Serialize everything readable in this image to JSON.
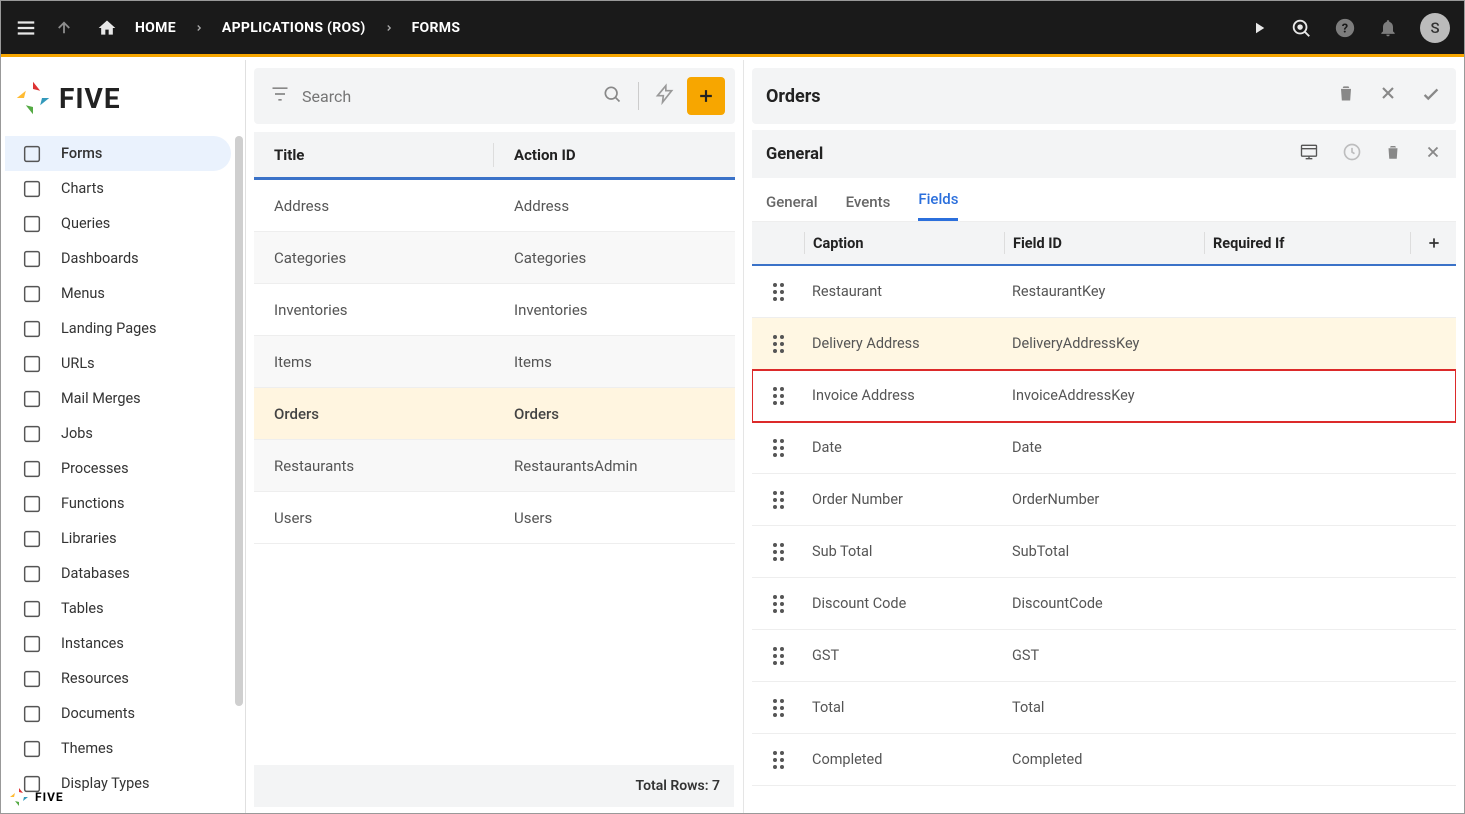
{
  "top": {
    "home": "HOME",
    "apps": "APPLICATIONS (ROS)",
    "forms": "FORMS",
    "avatar": "S"
  },
  "brand": {
    "name": "FIVE",
    "footer": "FIVE"
  },
  "sidebar": [
    {
      "label": "Forms",
      "sel": true
    },
    {
      "label": "Charts"
    },
    {
      "label": "Queries"
    },
    {
      "label": "Dashboards"
    },
    {
      "label": "Menus"
    },
    {
      "label": "Landing Pages"
    },
    {
      "label": "URLs"
    },
    {
      "label": "Mail Merges"
    },
    {
      "label": "Jobs"
    },
    {
      "label": "Processes"
    },
    {
      "label": "Functions"
    },
    {
      "label": "Libraries"
    },
    {
      "label": "Databases"
    },
    {
      "label": "Tables"
    },
    {
      "label": "Instances"
    },
    {
      "label": "Resources"
    },
    {
      "label": "Documents"
    },
    {
      "label": "Themes"
    },
    {
      "label": "Display Types"
    }
  ],
  "search": {
    "placeholder": "Search"
  },
  "listHead": {
    "title": "Title",
    "action": "Action ID"
  },
  "list": [
    {
      "title": "Address",
      "action": "Address"
    },
    {
      "title": "Categories",
      "action": "Categories"
    },
    {
      "title": "Inventories",
      "action": "Inventories"
    },
    {
      "title": "Items",
      "action": "Items"
    },
    {
      "title": "Orders",
      "action": "Orders",
      "sel": true
    },
    {
      "title": "Restaurants",
      "action": "RestaurantsAdmin"
    },
    {
      "title": "Users",
      "action": "Users"
    }
  ],
  "totalRows": "Total Rows: 7",
  "detail": {
    "title": "Orders",
    "section": "General"
  },
  "tabs": [
    "General",
    "Events",
    "Fields"
  ],
  "activeTab": 2,
  "fieldsHead": {
    "caption": "Caption",
    "fid": "Field ID",
    "req": "Required If"
  },
  "fields": [
    {
      "caption": "Restaurant",
      "fid": "RestaurantKey"
    },
    {
      "caption": "Delivery Address",
      "fid": "DeliveryAddressKey",
      "hl": true
    },
    {
      "caption": "Invoice Address",
      "fid": "InvoiceAddressKey",
      "red": true
    },
    {
      "caption": "Date",
      "fid": "Date"
    },
    {
      "caption": "Order Number",
      "fid": "OrderNumber"
    },
    {
      "caption": "Sub Total",
      "fid": "SubTotal"
    },
    {
      "caption": "Discount Code",
      "fid": "DiscountCode"
    },
    {
      "caption": "GST",
      "fid": "GST"
    },
    {
      "caption": "Total",
      "fid": "Total"
    },
    {
      "caption": "Completed",
      "fid": "Completed"
    }
  ]
}
